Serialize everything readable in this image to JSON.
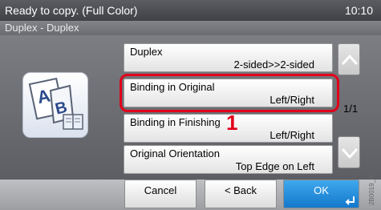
{
  "status_bar": {
    "message": "Ready to copy. (Full Color)",
    "clock": "10:10"
  },
  "header": {
    "title": "Duplex - Duplex"
  },
  "settings": [
    {
      "label": "Duplex",
      "value": "2-sided>>2-sided"
    },
    {
      "label": "Binding in Original",
      "value": "Left/Right"
    },
    {
      "label": "Binding in Finishing",
      "value": "Left/Right"
    },
    {
      "label": "Original Orientation",
      "value": "Top Edge on Left"
    }
  ],
  "callout": "1",
  "pagination": {
    "indicator": "1/1"
  },
  "footer": {
    "cancel_label": "Cancel",
    "back_label": "< Back",
    "ok_label": "OK"
  },
  "figure_code": "2B0019_01",
  "icons": {
    "function": "duplex-book-icon",
    "scroll_up": "chevron-up-icon",
    "scroll_down": "chevron-down-icon",
    "enter": "enter-icon"
  },
  "colors": {
    "highlight": "#e2001a",
    "ok_button": "#2a90de",
    "status_bar": "#4a4c50"
  }
}
